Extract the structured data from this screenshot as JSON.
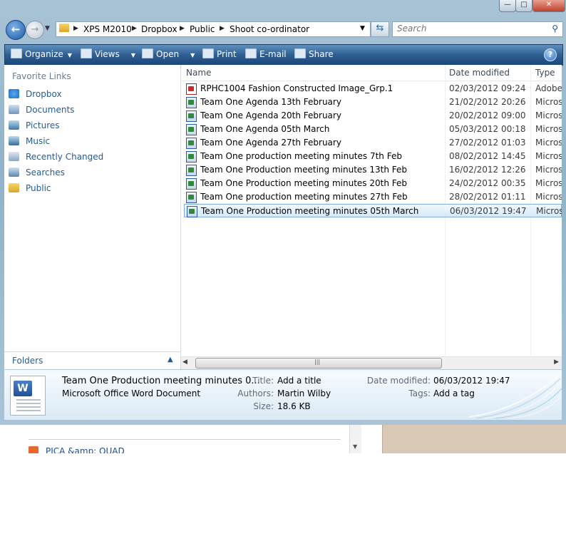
{
  "window": {
    "min_glyph": "—",
    "max_glyph": "□",
    "close_glyph": "✕"
  },
  "address": {
    "crumbs": [
      "XPS M2010",
      "Dropbox",
      "Public",
      "Shoot co-ordinator"
    ]
  },
  "search": {
    "placeholder": "Search"
  },
  "toolbar": {
    "organize": "Organize",
    "views": "Views",
    "open": "Open",
    "print": "Print",
    "email": "E-mail",
    "share": "Share",
    "help": "?"
  },
  "nav": {
    "favorites_header": "Favorite Links",
    "items": [
      {
        "label": "Dropbox",
        "icon": "dropbox-icon"
      },
      {
        "label": "Documents",
        "icon": "documents-icon"
      },
      {
        "label": "Pictures",
        "icon": "pictures-icon"
      },
      {
        "label": "Music",
        "icon": "music-icon"
      },
      {
        "label": "Recently Changed",
        "icon": "recently-changed-icon"
      },
      {
        "label": "Searches",
        "icon": "searches-icon"
      },
      {
        "label": "Public",
        "icon": "folder-icon"
      }
    ],
    "folders_label": "Folders"
  },
  "columns": {
    "name": "Name",
    "date_modified": "Date modified",
    "type": "Type"
  },
  "files": [
    {
      "name": "RPHC1004 Fashion Constructed Image_Grp.1",
      "date": "02/03/2012 09:24",
      "type": "Adobe",
      "icon": "pdf"
    },
    {
      "name": "Team One Agenda 13th February",
      "date": "21/02/2012 20:26",
      "type": "Microso",
      "icon": "word"
    },
    {
      "name": "Team One Agenda 20th February",
      "date": "20/02/2012 09:00",
      "type": "Microso",
      "icon": "word"
    },
    {
      "name": "Team One Agenda 05th March",
      "date": "05/03/2012 00:18",
      "type": "Microso",
      "icon": "word"
    },
    {
      "name": "Team One Agenda 27th February",
      "date": "27/02/2012 01:03",
      "type": "Microso",
      "icon": "word"
    },
    {
      "name": "Team One production meeting minutes 7th Feb",
      "date": "08/02/2012 14:45",
      "type": "Microso",
      "icon": "word"
    },
    {
      "name": "Team One Production meeting minutes 13th Feb",
      "date": "16/02/2012 12:26",
      "type": "Microso",
      "icon": "word"
    },
    {
      "name": "Team One Production meeting minutes 20th Feb",
      "date": "24/02/2012 00:35",
      "type": "Microso",
      "icon": "word"
    },
    {
      "name": "Team One production meeting minutes 27th Feb",
      "date": "28/02/2012 01:11",
      "type": "Microso",
      "icon": "word"
    },
    {
      "name": "Team One Production meeting minutes 05th March",
      "date": "06/03/2012 19:47",
      "type": "Microso",
      "icon": "word",
      "selected": true
    }
  ],
  "details": {
    "filename": "Team One Production meeting minutes 0...",
    "filetype": "Microsoft Office Word Document",
    "title_label": "Title:",
    "title_value": "Add a title",
    "authors_label": "Authors:",
    "authors_value": "Martin Wilby",
    "size_label": "Size:",
    "size_value": "18.6 KB",
    "modified_label": "Date modified:",
    "modified_value": "06/03/2012 19:47",
    "tags_label": "Tags:",
    "tags_value": "Add a tag"
  },
  "background_page": {
    "link_text": "PICA &amp; QUAD"
  },
  "colors": {
    "accent": "#1e5c9c",
    "command_bar": "#2f5f92",
    "selection": "#d5eafa"
  }
}
